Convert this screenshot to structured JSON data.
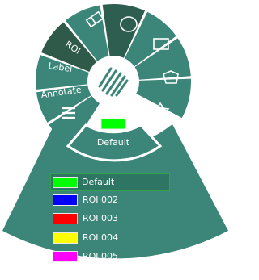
{
  "menu": {
    "center_icon": "hatch-icon",
    "sector_labels": {
      "roi": "ROI",
      "label": "Label",
      "annotate": "Annotate"
    },
    "tool_icons": [
      "eraser-icon",
      "ellipse-icon",
      "rectangle-icon",
      "polygon-icon",
      "star-icon",
      "hamburger-menu-icon"
    ],
    "current_roi": {
      "label": "Default",
      "color": "#00ff00"
    }
  },
  "roi_list": [
    {
      "label": "Default",
      "color": "#00ff00",
      "selected": true
    },
    {
      "label": "ROI 002",
      "color": "#0000ff",
      "selected": false
    },
    {
      "label": "ROI 003",
      "color": "#ff0000",
      "selected": false
    },
    {
      "label": "ROI 004",
      "color": "#ffff00",
      "selected": false
    },
    {
      "label": "ROI 005",
      "color": "#ff00ff",
      "selected": false
    }
  ],
  "colors": {
    "sector_fill": "#3c8679",
    "sector_fill_dark": "#2e5e4f",
    "sector_fill_selected": "#2f5a4a",
    "stroke": "#ffffff"
  }
}
